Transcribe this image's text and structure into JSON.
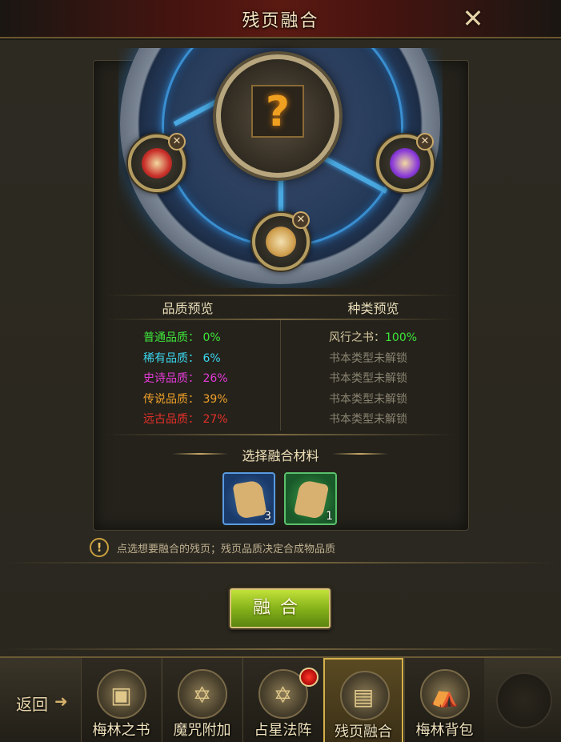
{
  "header": {
    "title": "残页融合",
    "close_glyph": "✕"
  },
  "preview": {
    "quality_header": "品质预览",
    "type_header": "种类预览",
    "quality_rows": [
      {
        "text": "普通品质：  0%",
        "color": "#3ee63a"
      },
      {
        "text": "稀有品质：  6%",
        "color": "#3ad8f0"
      },
      {
        "text": "史诗品质：  26%",
        "color": "#e63ad8"
      },
      {
        "text": "传说品质：  39%",
        "color": "#f0a02a"
      },
      {
        "text": "远古品质：  27%",
        "color": "#e6302a"
      }
    ],
    "type_rows": [
      {
        "name": "风行之书：",
        "value": "100%"
      },
      {
        "name": "书本类型未解锁",
        "value": ""
      },
      {
        "name": "书本类型未解锁",
        "value": ""
      },
      {
        "name": "书本类型未解锁",
        "value": ""
      },
      {
        "name": "书本类型未解锁",
        "value": ""
      }
    ]
  },
  "center_slot": {
    "glyph": "?"
  },
  "materials": {
    "title": "选择融合材料",
    "items": [
      {
        "count": "3",
        "frame_color": "#2a6ec8"
      },
      {
        "count": "1",
        "frame_color": "#2a9a3a"
      }
    ]
  },
  "hint": {
    "icon": "!",
    "text": "点选想要融合的残页；残页品质决定合成物品质"
  },
  "fuse_button": {
    "label": "融合"
  },
  "nav": {
    "back_label": "返回",
    "tabs": [
      {
        "label": "梅林之书",
        "icon": "book-icon"
      },
      {
        "label": "魔咒附加",
        "icon": "hexagram-icon"
      },
      {
        "label": "占星法阵",
        "icon": "astral-icon"
      },
      {
        "label": "残页融合",
        "icon": "scroll-icon"
      },
      {
        "label": "梅林背包",
        "icon": "backpack-icon"
      }
    ]
  }
}
